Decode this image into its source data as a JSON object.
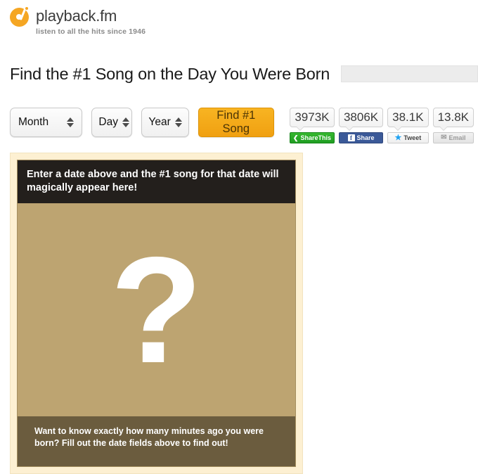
{
  "brand": {
    "logo_icon": "turntable-record-icon",
    "name": "playback.fm",
    "tagline": "listen to all the hits since 1946",
    "accent_color": "#f5a623"
  },
  "headline": {
    "text": "Find the #1 Song on the Day You Were Born"
  },
  "ad_slot": {
    "name": "ad-placeholder",
    "fill_color": "#ececec"
  },
  "form": {
    "month": {
      "label": "Month",
      "stepper_icon": "stepper-updown-icon"
    },
    "day": {
      "label": "Day",
      "stepper_icon": "stepper-updown-icon"
    },
    "year": {
      "label": "Year",
      "stepper_icon": "stepper-updown-icon"
    },
    "submit_label": "Find #1 Song",
    "submit_color": "#f5a81c"
  },
  "share": [
    {
      "count": "3973K",
      "button_label": "ShareThis",
      "icon": "share-nodes-icon",
      "color": "#2aa828"
    },
    {
      "count": "3806K",
      "button_label": "Share",
      "icon": "facebook-f-icon",
      "glyph": "f",
      "color": "#3b5998"
    },
    {
      "count": "38.1K",
      "button_label": "Tweet",
      "icon": "twitter-bird-icon",
      "color": "#1da1f2"
    },
    {
      "count": "13.8K",
      "button_label": "Email",
      "icon": "envelope-icon",
      "color": "#9a9a9a"
    }
  ],
  "result_panel": {
    "frame_color": "#fdf0d2",
    "body_color": "#bda471",
    "header_text": "Enter a date above and the #1 song for that date will magically appear here!",
    "header_color": "#231f1c",
    "placeholder_glyph": "?",
    "footer_text": "Want to know exactly how many minutes ago you were born? Fill out the date fields above to find out!",
    "footer_color": "#6b5c3e"
  }
}
